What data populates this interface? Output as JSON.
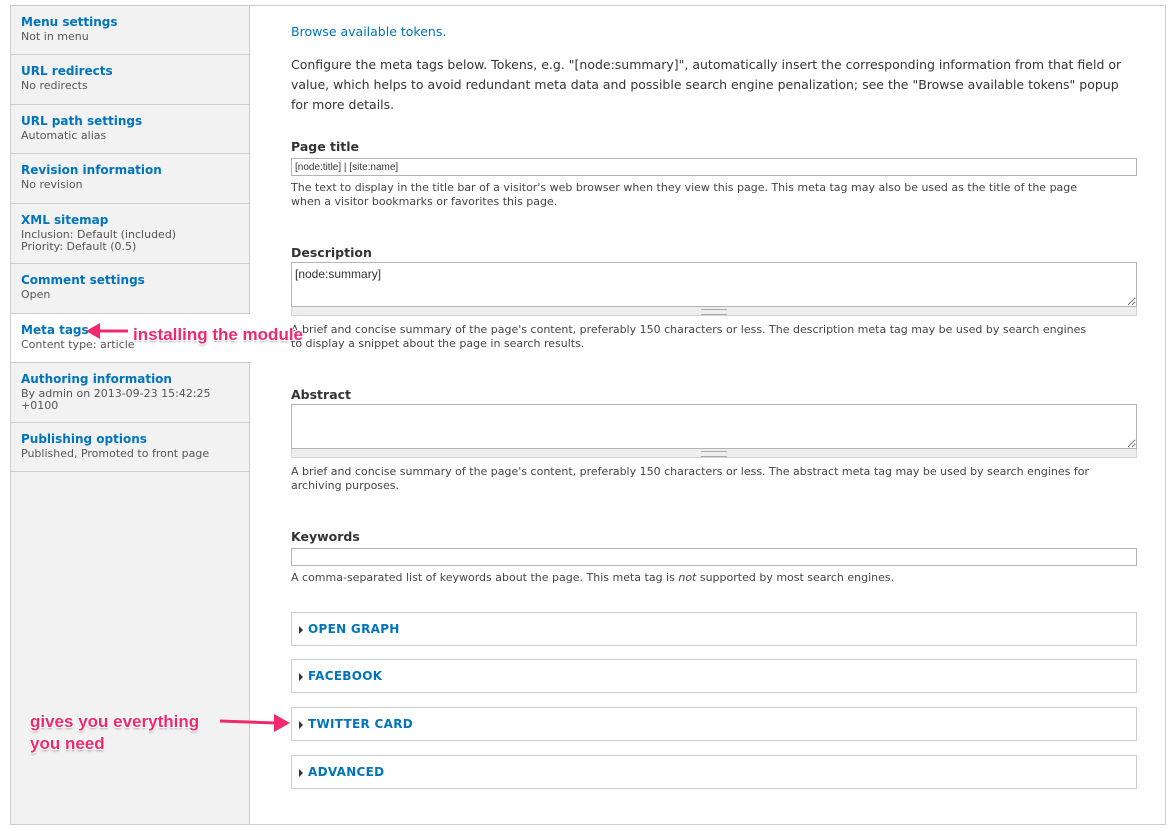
{
  "sidebar": {
    "tabs": [
      {
        "title": "Menu settings",
        "summary": [
          "Not in menu"
        ]
      },
      {
        "title": "URL redirects",
        "summary": [
          "No redirects"
        ]
      },
      {
        "title": "URL path settings",
        "summary": [
          "Automatic alias"
        ]
      },
      {
        "title": "Revision information",
        "summary": [
          "No revision"
        ]
      },
      {
        "title": "XML sitemap",
        "summary": [
          "Inclusion: Default (included)",
          "Priority: Default (0.5)"
        ]
      },
      {
        "title": "Comment settings",
        "summary": [
          "Open"
        ]
      },
      {
        "title": "Meta tags",
        "summary": [
          "Content type: article"
        ]
      },
      {
        "title": "Authoring information",
        "summary": [
          "By admin on 2013-09-23 15:42:25",
          "+0100"
        ]
      },
      {
        "title": "Publishing options",
        "summary": [
          "Published, Promoted to front page"
        ]
      }
    ]
  },
  "main": {
    "browse_tokens_link": "Browse available tokens.",
    "intro_line1": "Configure the meta tags below. Tokens, e.g. \"[node:summary]\", automatically insert the corresponding information from that field or",
    "intro_line2": "value, which helps to avoid redundant meta data and possible search engine penalization; see the \"Browse available tokens\" popup",
    "intro_line3": "for more details.",
    "page_title": {
      "label": "Page title",
      "value": "[node:title] | [site:name]",
      "desc_line1": "The text to display in the title bar of a visitor's web browser when they view this page. This meta tag may also be used as the title of the page",
      "desc_line2": "when a visitor bookmarks or favorites this page."
    },
    "description": {
      "label": "Description",
      "value": "[node:summary]",
      "desc_line1": "A brief and concise summary of the page's content, preferably 150 characters or less. The description meta tag may be used by search engines",
      "desc_line2": "to display a snippet about the page in search results."
    },
    "abstract": {
      "label": "Abstract",
      "value": "",
      "desc_line1": "A brief and concise summary of the page's content, preferably 150 characters or less. The abstract meta tag may be used by search engines for",
      "desc_line2": "archiving purposes."
    },
    "keywords": {
      "label": "Keywords",
      "value": "",
      "desc_before": "A comma-separated list of keywords about the page. This meta tag is ",
      "desc_em": "not",
      "desc_after": " supported by most search engines."
    },
    "fieldsets": [
      "OPEN GRAPH",
      "FACEBOOK",
      "TWITTER CARD",
      "ADVANCED"
    ]
  },
  "annotations": {
    "installing": "installing the module",
    "everything_line1": "gives you everything",
    "everything_line2": "you need",
    "color": "#f0286e"
  },
  "colors": {
    "link": "#0074bd",
    "sidebar_bg": "#f2f2f2"
  }
}
